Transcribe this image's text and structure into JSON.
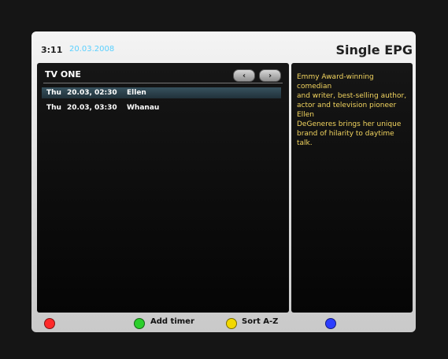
{
  "header": {
    "time": "3:11",
    "date": "20.03.2008",
    "title": "Single EPG"
  },
  "channel": {
    "name": "TV ONE"
  },
  "navigation": {
    "prev_icon": "‹",
    "next_icon": "›"
  },
  "program_list": [
    {
      "day": "Thu",
      "time": "20.03, 02:30",
      "title": "Ellen",
      "selected": true
    },
    {
      "day": "Thu",
      "time": "20.03, 03:30",
      "title": "Whanau",
      "selected": false
    }
  ],
  "description": {
    "text": "Emmy Award-winning comedian\nand writer, best-selling author,\nactor and television pioneer Ellen\nDeGeneres brings her unique\nbrand of hilarity to daytime talk."
  },
  "footer": {
    "red": {
      "label": "",
      "color": "#ff2a2a"
    },
    "green": {
      "label": "Add timer",
      "color": "#2ccf2c"
    },
    "yellow": {
      "label": "Sort A-Z",
      "color": "#f2d800"
    },
    "blue": {
      "label": "",
      "color": "#2c3dff"
    }
  }
}
